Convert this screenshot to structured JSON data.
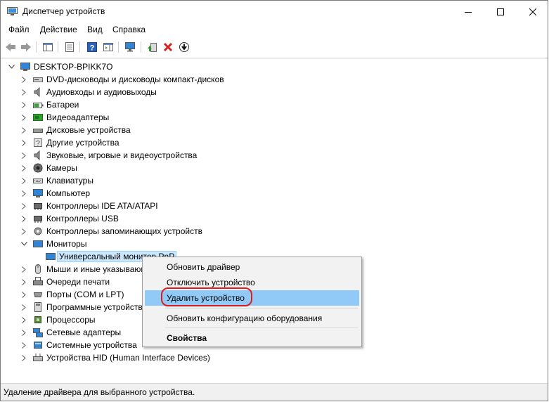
{
  "window": {
    "title": "Диспетчер устройств"
  },
  "menu": [
    "Файл",
    "Действие",
    "Вид",
    "Справка"
  ],
  "tree": {
    "root": "DESKTOP-BPIKK7O",
    "categories": [
      {
        "label": "DVD-дисководы и дисководы компакт-дисков",
        "icon": "dvd-drive-icon"
      },
      {
        "label": "Аудиовходы и аудиовыходы",
        "icon": "speaker-icon"
      },
      {
        "label": "Батареи",
        "icon": "battery-icon"
      },
      {
        "label": "Видеоадаптеры",
        "icon": "display-adapter-icon"
      },
      {
        "label": "Дисковые устройства",
        "icon": "disk-drive-icon"
      },
      {
        "label": "Другие устройства",
        "icon": "unknown-device-icon"
      },
      {
        "label": "Звуковые, игровые и видеоустройства",
        "icon": "sound-icon"
      },
      {
        "label": "Камеры",
        "icon": "camera-icon"
      },
      {
        "label": "Клавиатуры",
        "icon": "keyboard-icon"
      },
      {
        "label": "Компьютер",
        "icon": "computer-icon"
      },
      {
        "label": "Контроллеры IDE ATA/ATAPI",
        "icon": "ide-controller-icon"
      },
      {
        "label": "Контроллеры USB",
        "icon": "usb-controller-icon"
      },
      {
        "label": "Контроллеры запоминающих устройств",
        "icon": "storage-controller-icon"
      },
      {
        "label": "Мониторы",
        "icon": "monitor-icon"
      },
      {
        "label": "Универсальный монитор PnP",
        "icon": "monitor-icon"
      },
      {
        "label": "Мыши и иные указывающие устройства",
        "icon": "mouse-icon"
      },
      {
        "label": "Очереди печати",
        "icon": "printer-icon"
      },
      {
        "label": "Порты (COM и LPT)",
        "icon": "port-icon"
      },
      {
        "label": "Программные устройства",
        "icon": "software-device-icon"
      },
      {
        "label": "Процессоры",
        "icon": "processor-icon"
      },
      {
        "label": "Сетевые адаптеры",
        "icon": "network-adapter-icon"
      },
      {
        "label": "Системные устройства",
        "icon": "system-device-icon"
      },
      {
        "label": "Устройства HID (Human Interface Devices)",
        "icon": "hid-icon"
      }
    ]
  },
  "context_menu": {
    "update": "Обновить драйвер",
    "disable": "Отключить устройство",
    "uninstall": "Удалить устройство",
    "scan": "Обновить конфигурацию оборудования",
    "properties": "Свойства"
  },
  "status": "Удаление драйвера для выбранного устройства."
}
